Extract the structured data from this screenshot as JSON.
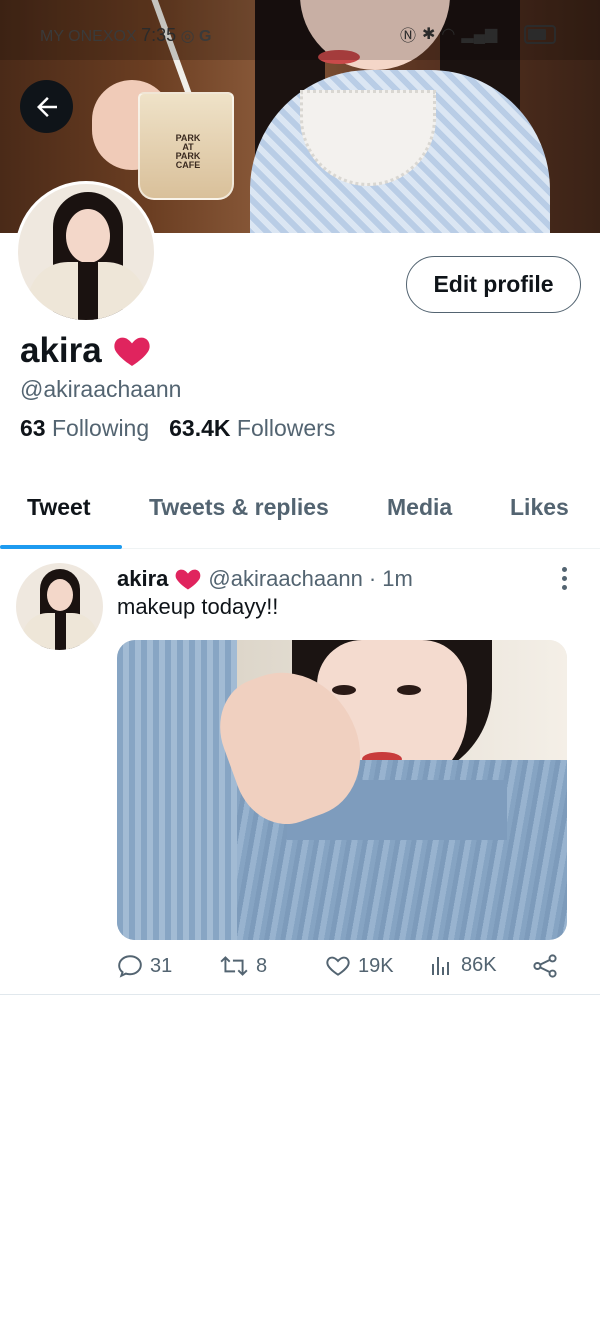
{
  "status_bar": {
    "carrier": "MY ONEXOX",
    "time": "7:35"
  },
  "banner": {
    "cup_label": "PARK AT PARK CAFE"
  },
  "profile": {
    "edit_button": "Edit profile",
    "name": "akira",
    "handle": "@akiraachaann",
    "following_count": "63",
    "following_label": "Following",
    "followers_count": "63.4K",
    "followers_label": "Followers"
  },
  "tabs": [
    {
      "label": "Tweet",
      "active": true
    },
    {
      "label": "Tweets & replies",
      "active": false
    },
    {
      "label": "Media",
      "active": false
    },
    {
      "label": "Likes",
      "active": false
    }
  ],
  "tweet": {
    "name": "akira",
    "handle": "@akiraachaann",
    "time": "· 1m",
    "text": "makeup todayy!!",
    "replies": "31",
    "retweets": "8",
    "likes": "19K",
    "views": "86K"
  },
  "colors": {
    "accent": "#1d9bf0",
    "secondary_text": "#536471",
    "heart": "#e0245e"
  }
}
